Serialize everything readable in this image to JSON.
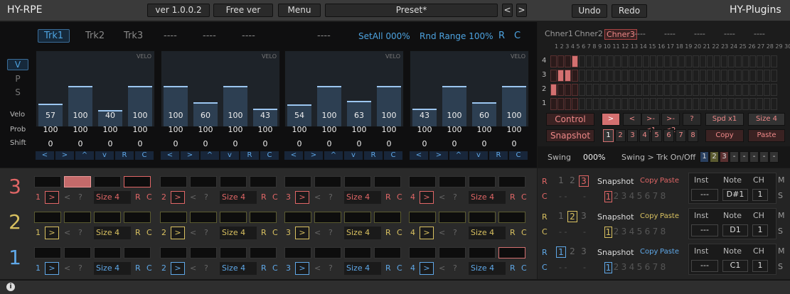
{
  "app": {
    "title": "HY-RPE",
    "brand": "HY-Plugins"
  },
  "topbar": {
    "version": "ver 1.0.0.2",
    "edition": "Free ver",
    "menu": "Menu",
    "preset": "Preset*",
    "prev": "<",
    "next": ">",
    "undo": "Undo",
    "redo": "Redo"
  },
  "tabs": [
    {
      "label": "Trk1"
    },
    {
      "label": "Trk2"
    },
    {
      "label": "Trk3"
    },
    {
      "label": "----"
    },
    {
      "label": "----"
    },
    {
      "label": "----"
    },
    {
      "label": "----"
    }
  ],
  "set_all": "SetAll 000%",
  "rnd_range": "Rnd Range 100%",
  "rc": {
    "r": "R",
    "c": "C"
  },
  "vps": [
    {
      "label": "V"
    },
    {
      "label": "P"
    },
    {
      "label": "S"
    }
  ],
  "velo_tag": "VELO",
  "row_labels": {
    "velo": "Velo",
    "prob": "Prob",
    "shift": "Shift"
  },
  "graphs": [
    {
      "velo": [
        57,
        100,
        40,
        100
      ],
      "prob": [
        100,
        100,
        100,
        100
      ],
      "shift": [
        0,
        0,
        0,
        0
      ]
    },
    {
      "velo": [
        100,
        60,
        100,
        43
      ],
      "prob": [
        100,
        100,
        100,
        100
      ],
      "shift": [
        0,
        0,
        0,
        0
      ]
    },
    {
      "velo": [
        54,
        100,
        63,
        100
      ],
      "prob": [
        100,
        100,
        100,
        100
      ],
      "shift": [
        0,
        0,
        0,
        0
      ]
    },
    {
      "velo": [
        43,
        100,
        60,
        100
      ],
      "prob": [
        100,
        100,
        100,
        100
      ],
      "shift": [
        0,
        0,
        0,
        0
      ]
    }
  ],
  "nav_buttons": [
    "<",
    ">",
    "^",
    "v",
    "R",
    "C"
  ],
  "channers": [
    {
      "label": "Chner1"
    },
    {
      "label": "Chner2"
    },
    {
      "label": "Chner3"
    },
    {
      "label": "----"
    },
    {
      "label": "----"
    },
    {
      "label": "----"
    },
    {
      "label": "----"
    },
    {
      "label": "----"
    }
  ],
  "step_numbers": "1 2 3 4 5 6 7 8 9 10 11 12 13 14 15 16 17 18 19 20 21 22 23 24 25 26 27 28 29 30 31 32",
  "grid_rows": [
    "4",
    "3",
    "2",
    "1"
  ],
  "control_label": "Control",
  "snapshot_label": "Snapshot",
  "play_modes": [
    ">",
    "<",
    ">-<1",
    ">-<2",
    "?"
  ],
  "speed": "Spd x1",
  "size": "Size 4",
  "snapshots": [
    "1",
    "2",
    "3",
    "4",
    "5",
    "6",
    "7",
    "8"
  ],
  "copy": "Copy",
  "paste": "Paste",
  "swing_label": "Swing",
  "swing_value": "000%",
  "swing_trk": "Swing > Trk On/Off",
  "swing_toggles": [
    "1",
    "2",
    "3",
    "-",
    "-",
    "-",
    "-",
    "-"
  ],
  "lanes": [
    {
      "num": "3",
      "color": "#e06666",
      "ctrl_num": [
        "1",
        "2",
        "3",
        "4"
      ],
      "size": "Size 4",
      "mode": ">",
      "note": "D#1",
      "ch": "1",
      "snap_active": "1",
      "active_idx": "3"
    },
    {
      "num": "2",
      "color": "#d9c160",
      "ctrl_num": [
        "1",
        "2",
        "3",
        "4"
      ],
      "size": "Size 4",
      "mode": ">",
      "note": "D1",
      "ch": "1",
      "snap_active": "1",
      "active_idx": "2"
    },
    {
      "num": "1",
      "color": "#5fa8e8",
      "ctrl_num": [
        "1",
        "2",
        "3",
        "4"
      ],
      "size": "Size 4",
      "mode": ">",
      "note": "C1",
      "ch": "1",
      "snap_active": "1",
      "active_idx": "1"
    }
  ],
  "lane_labels": {
    "snapshot": "Snapshot",
    "inst": "Inst",
    "note": "Note",
    "ch": "CH",
    "inst_val": "---",
    "m": "M",
    "s": "S",
    "q": "?",
    "lt": "<",
    "dashes": "- -",
    "dash": "-"
  },
  "colors": {
    "red": "#e06666",
    "yellow": "#d9c160",
    "blue": "#5fa8e8"
  }
}
